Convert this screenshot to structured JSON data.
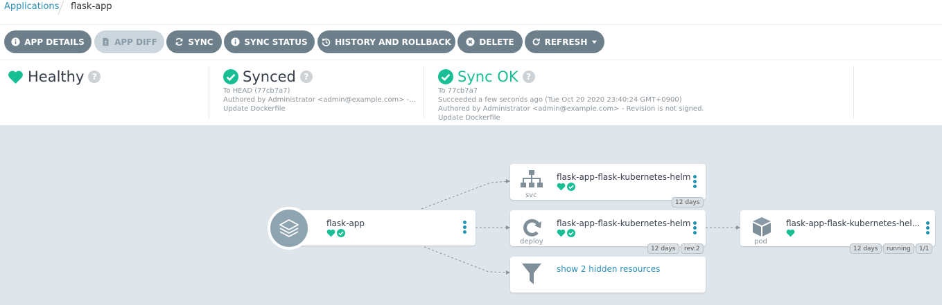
{
  "breadcrumb": {
    "root": "Applications",
    "current": "flask-app"
  },
  "toolbar": {
    "app_details": "APP DETAILS",
    "app_diff": "APP DIFF",
    "sync": "SYNC",
    "sync_status": "SYNC STATUS",
    "history": "HISTORY AND ROLLBACK",
    "delete": "DELETE",
    "refresh": "REFRESH"
  },
  "status": {
    "health": {
      "label": "Healthy"
    },
    "sync": {
      "label": "Synced",
      "to": "To HEAD (77cb7a7)",
      "author": "Authored by Administrator <admin@example.com> -...",
      "message": "Update Dockerfile"
    },
    "operation": {
      "label": "Sync OK",
      "to": "To 77cb7a7",
      "result": "Succeeded a few seconds ago (Tue Oct 20 2020 23:40:24 GMT+0900)",
      "author": "Authored by Administrator <admin@example.com> - Revision is not signed.",
      "message": "Update Dockerfile"
    }
  },
  "tree": {
    "app": {
      "name": "flask-app"
    },
    "svc": {
      "name": "flask-app-flask-kubernetes-helm",
      "kind": "svc",
      "tags": [
        "12 days"
      ]
    },
    "deploy": {
      "name": "flask-app-flask-kubernetes-helm",
      "kind": "deploy",
      "tags": [
        "12 days",
        "rev:2"
      ]
    },
    "hidden": {
      "label": "show 2 hidden resources"
    },
    "pod": {
      "name": "flask-app-flask-kubernetes-hel...",
      "kind": "pod",
      "tags": [
        "12 days",
        "running",
        "1/1"
      ]
    }
  },
  "colors": {
    "healthy": "#18be94",
    "button": "#6d7f8b",
    "link": "#2a8fb8",
    "canvas": "#dee6eb"
  }
}
